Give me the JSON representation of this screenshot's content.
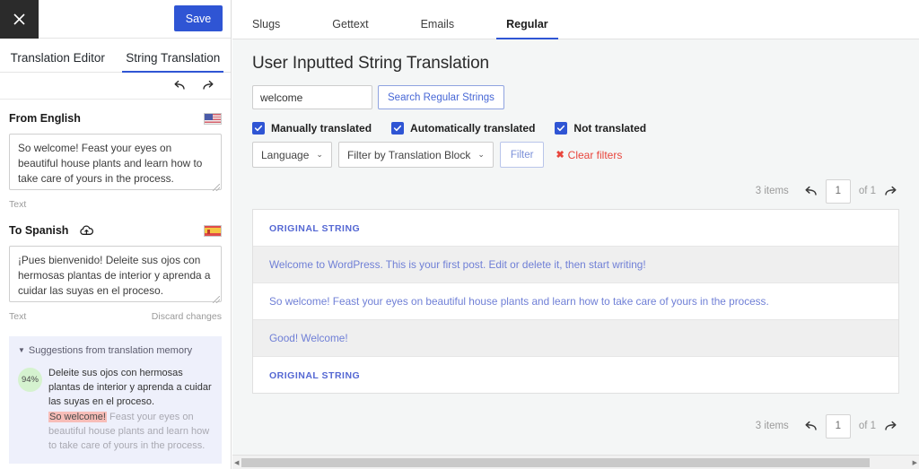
{
  "editor": {
    "close_icon": "close-icon",
    "save_label": "Save",
    "tabs": [
      {
        "label": "Translation Editor",
        "active": false
      },
      {
        "label": "String Translation",
        "active": true
      }
    ],
    "undo_icon": "undo-arrow-icon",
    "redo_icon": "redo-arrow-icon",
    "source": {
      "title": "From English",
      "flag": "us-flag-icon",
      "value": "So welcome! Feast your eyes on beautiful house plants and learn how to take care of yours in the process.",
      "under_label": "Text"
    },
    "target": {
      "title": "To Spanish",
      "cloud_icon": "cloud-upload-icon",
      "flag": "es-flag-icon",
      "value": "¡Pues bienvenido! Deleite sus ojos con hermosas plantas de interior y aprenda a cuidar las suyas en el proceso.",
      "under_label": "Text",
      "discard_label": "Discard changes"
    },
    "suggestions": {
      "header": "Suggestions from translation memory",
      "caret": "▼",
      "percent": "94%",
      "target_text": "Deleite sus ojos con hermosas plantas de interior y aprenda a cuidar las suyas en el proceso.",
      "source_highlight": "So welcome!",
      "source_rest": " Feast your eyes on beautiful house plants and learn how to take care of yours in the process."
    }
  },
  "main": {
    "tabs": [
      {
        "label": "Slugs",
        "active": false
      },
      {
        "label": "Gettext",
        "active": false
      },
      {
        "label": "Emails",
        "active": false
      },
      {
        "label": "Regular",
        "active": true
      }
    ],
    "page_title": "User Inputted String Translation",
    "search": {
      "value": "welcome",
      "placeholder": "",
      "button_label": "Search Regular Strings"
    },
    "checkboxes": [
      {
        "label": "Manually translated",
        "checked": true
      },
      {
        "label": "Automatically translated",
        "checked": true
      },
      {
        "label": "Not translated",
        "checked": true
      }
    ],
    "filters": {
      "language_select": "Language",
      "block_select": "Filter by Translation Block",
      "filter_button": "Filter",
      "clear_filters": "Clear filters",
      "clear_icon": "x-icon",
      "chevron": "⌄"
    },
    "pagination_top": {
      "items": "3 items",
      "prev_icon": "prev-arrow-icon",
      "page": "1",
      "of": "of 1",
      "next_icon": "next-arrow-icon"
    },
    "pagination_bottom": {
      "items": "3 items",
      "prev_icon": "prev-arrow-icon",
      "page": "1",
      "of": "of 1",
      "next_icon": "next-arrow-icon"
    },
    "table": {
      "column_header": "ORIGINAL STRING",
      "column_header_footer": "ORIGINAL STRING",
      "rows": [
        {
          "text": "Welcome to WordPress. This is your first post. Edit or delete it, then start writing!"
        },
        {
          "text": "So welcome! Feast your eyes on beautiful house plants and learn how to take care of yours in the process."
        },
        {
          "text": "Good! Welcome!"
        }
      ]
    }
  },
  "colors": {
    "accent": "#2f55d4",
    "link": "#6f7fd6",
    "danger": "#e8453c",
    "header_link": "#5568d3"
  }
}
